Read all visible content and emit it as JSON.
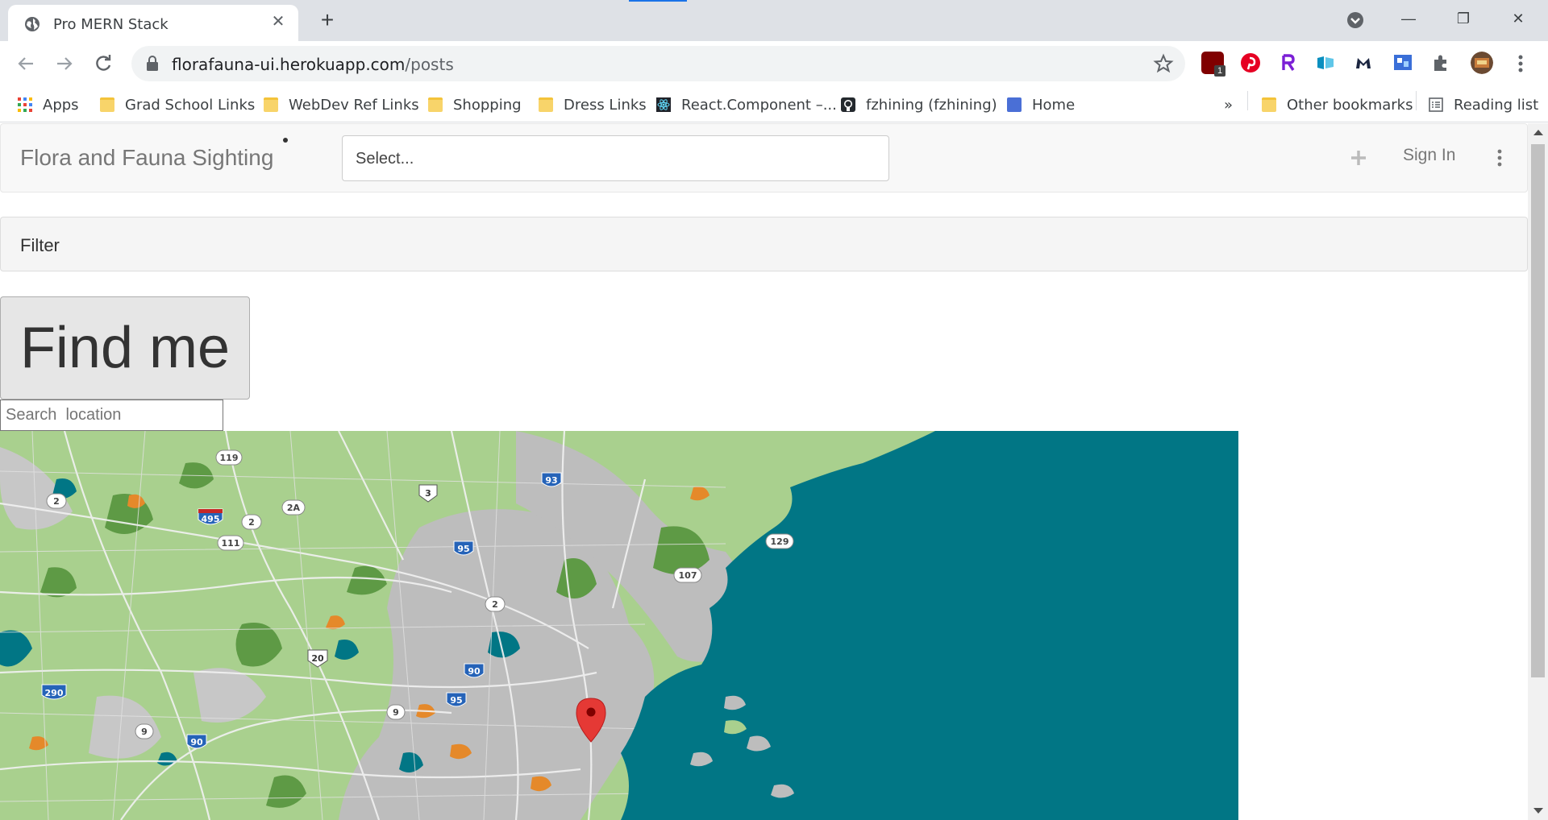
{
  "browser": {
    "tab_title": "Pro MERN Stack",
    "url_domain": "florafauna-ui.herokuapp.com",
    "url_path": "/posts",
    "bookmarks": [
      {
        "label": "Apps",
        "icon": "apps-grid-icon"
      },
      {
        "label": "Grad School Links",
        "icon": "folder-icon"
      },
      {
        "label": "WebDev Ref Links",
        "icon": "folder-icon"
      },
      {
        "label": "Shopping",
        "icon": "folder-icon"
      },
      {
        "label": "Dress Links",
        "icon": "folder-icon"
      },
      {
        "label": "React.Component –...",
        "icon": "react-icon"
      },
      {
        "label": "fzhining (fzhining)",
        "icon": "github-icon"
      },
      {
        "label": "Home",
        "icon": "page-icon"
      }
    ],
    "overflow_label": "»",
    "other_bookmarks": "Other bookmarks",
    "reading_list": "Reading list",
    "extension_badge": "1"
  },
  "app": {
    "brand": "Flora and Fauna Sighting",
    "select_placeholder": "Select...",
    "sign_in": "Sign In",
    "filter_title": "Filter",
    "find_me": "Find me",
    "search_placeholder": "Search  location"
  },
  "map": {
    "water_color": "#017685",
    "land_color": "#a9d08e",
    "road_labels": [
      "119",
      "2",
      "495",
      "2",
      "2A",
      "3",
      "93",
      "111",
      "95",
      "129",
      "107",
      "2",
      "20",
      "90",
      "290",
      "95",
      "9",
      "9",
      "90"
    ]
  }
}
